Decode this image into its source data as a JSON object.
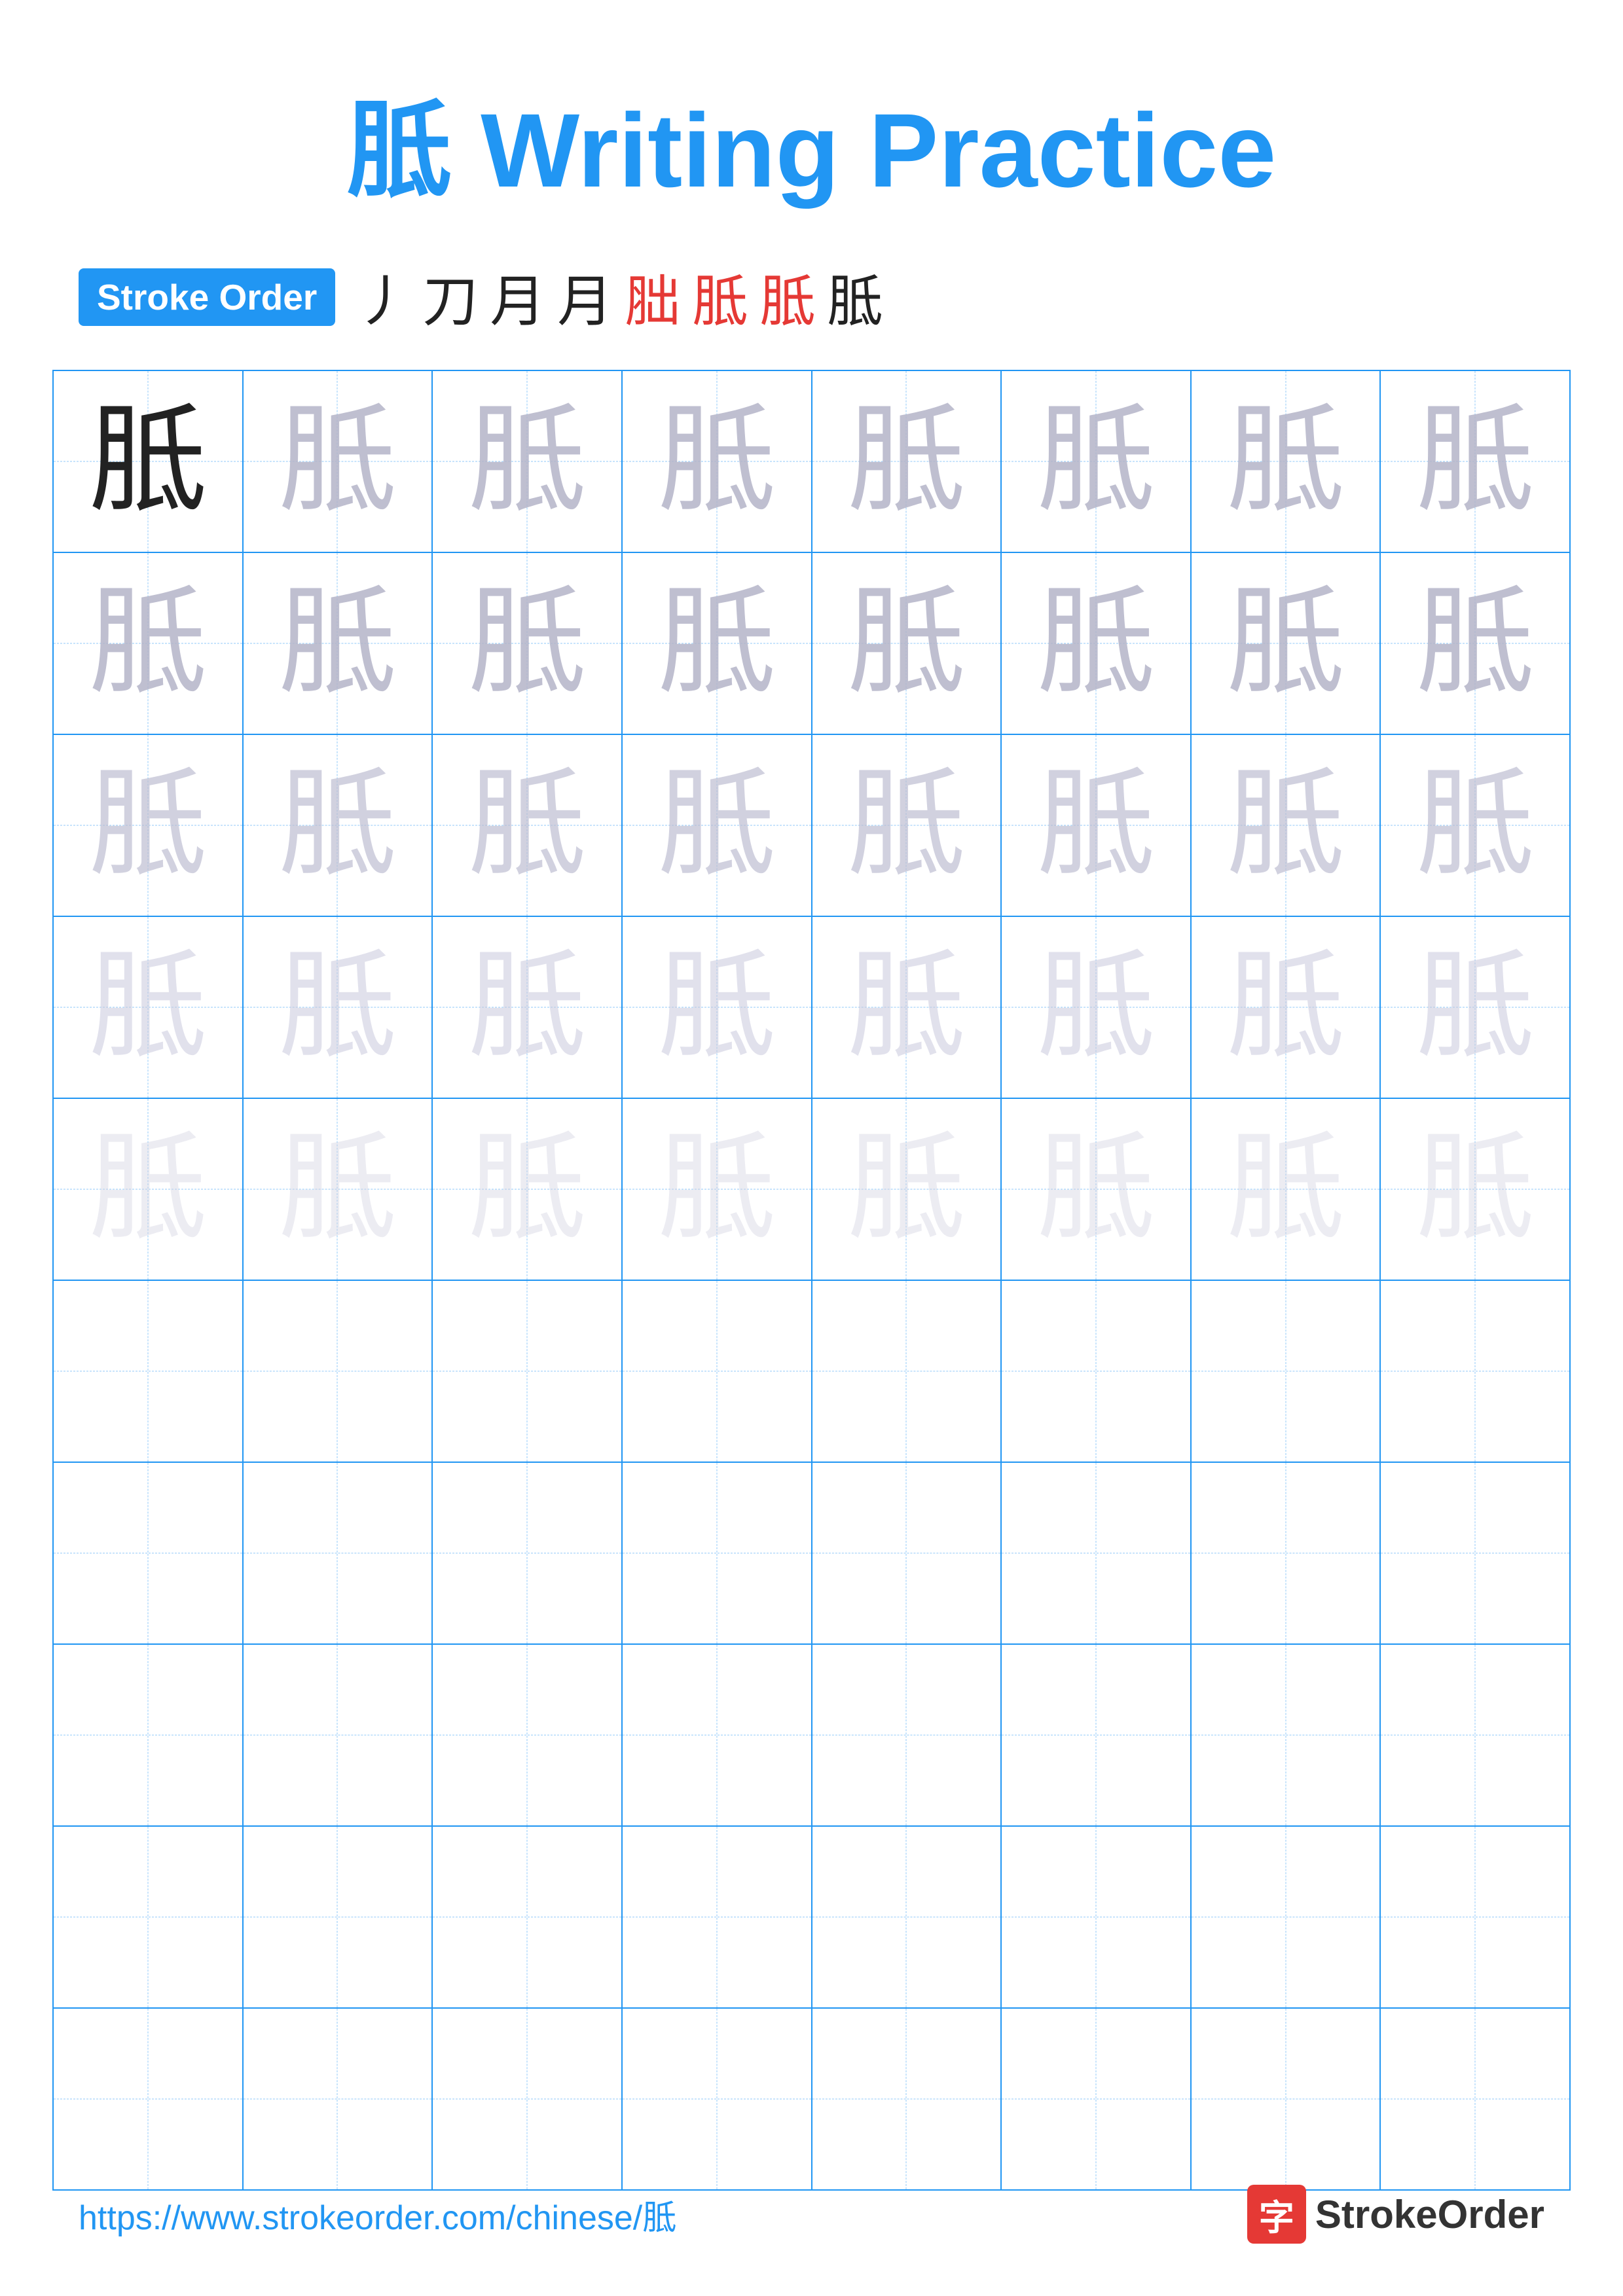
{
  "title": {
    "char": "胝",
    "text": " Writing Practice"
  },
  "stroke_order": {
    "badge": "Stroke Order",
    "strokes": [
      "丿",
      "刀",
      "月",
      "月",
      "胐",
      "胝",
      "胝",
      "胝"
    ]
  },
  "grid": {
    "rows": 10,
    "cols": 8,
    "char": "胝",
    "opacities": [
      [
        "dark",
        "light1",
        "light1",
        "light1",
        "light1",
        "light1",
        "light1",
        "light1"
      ],
      [
        "light1",
        "light1",
        "light1",
        "light1",
        "light1",
        "light1",
        "light1",
        "light1"
      ],
      [
        "light2",
        "light2",
        "light2",
        "light2",
        "light2",
        "light2",
        "light2",
        "light2"
      ],
      [
        "light3",
        "light3",
        "light3",
        "light3",
        "light3",
        "light3",
        "light3",
        "light3"
      ],
      [
        "light4",
        "light4",
        "light4",
        "light4",
        "light4",
        "light4",
        "light4",
        "light4"
      ],
      [
        "empty",
        "empty",
        "empty",
        "empty",
        "empty",
        "empty",
        "empty",
        "empty"
      ],
      [
        "empty",
        "empty",
        "empty",
        "empty",
        "empty",
        "empty",
        "empty",
        "empty"
      ],
      [
        "empty",
        "empty",
        "empty",
        "empty",
        "empty",
        "empty",
        "empty",
        "empty"
      ],
      [
        "empty",
        "empty",
        "empty",
        "empty",
        "empty",
        "empty",
        "empty",
        "empty"
      ],
      [
        "empty",
        "empty",
        "empty",
        "empty",
        "empty",
        "empty",
        "empty",
        "empty"
      ]
    ]
  },
  "footer": {
    "url": "https://www.strokeorder.com/chinese/胝",
    "logo_char": "字",
    "logo_text": "StrokeOrder"
  }
}
